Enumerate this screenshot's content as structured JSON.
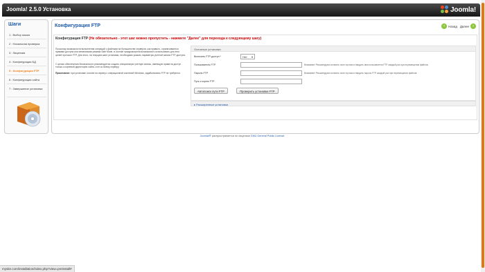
{
  "header": {
    "title": "Joomla! 2.5.0 Установка",
    "logo_text": "Joomla!"
  },
  "sidebar": {
    "title": "Шаги",
    "steps": [
      {
        "label": "1 : Выбор языка"
      },
      {
        "label": "2 : Начальная проверка"
      },
      {
        "label": "3 : Лицензия"
      },
      {
        "label": "4 : Конфигурация БД"
      },
      {
        "label": "5 : Конфигурация FTP"
      },
      {
        "label": "6 : Конфигурация сайта"
      },
      {
        "label": "7 : Завершение установки"
      }
    ],
    "active_step": 4
  },
  "main": {
    "title": "Конфигурация FTP",
    "back_label": "Назад",
    "next_label": "Далее",
    "section_title": "Конфигурация FTP",
    "section_note": "(Не обязательно - этот шаг можно пропустить - нажмите \"Далее\" для перехода к следующему шагу)",
    "intro_1": "Поскольку возможности выполнения операций с файлами на большинстве серверов, как правило, ограничиваются правами доступа или механизмом режима Safe Mode, в Joomla! предусмотрена возможность использовать для этих целей протокол FTP. Для этого, на текущем шаге установки, необходимо указать параметры учетной записи FTP-доступа.",
    "intro_2": "С целью обеспечения безопасности рекомендуется создать специальную учетную запись, имеющую права на доступ только к корневой директории сайта, а не ко всему серверу.",
    "intro_3_bold": "Примечание:",
    "intro_3": "при установке Joomla! на сервер с операционной системой Windows, задействовать FTP не требуется.",
    "settings": {
      "header": "Основные установки",
      "enable_label": "Включить FTP-доступ:*",
      "enable_value": "Нет",
      "user_label": "Пользователь FTP",
      "user_value": "",
      "user_hint": "Внимание! Рекомендуем оставить поле пустым и вводить имя пользователя FTP каждый раз при перемещении файлов.",
      "password_label": "Пароль FTP",
      "password_value": "",
      "password_hint": "Внимание! Рекомендуем оставить поле пустым и вводить пароль FTP каждый раз при перемещении файлов.",
      "path_label": "Путь к корню FTP",
      "path_value": "",
      "autofind_label": "Автопоиск пути FTP",
      "verify_label": "Проверить установки FTP"
    },
    "advanced_label": "Расширенные установки"
  },
  "footer": {
    "joomla": "Joomla!®",
    "text": " распространяется по лицензии ",
    "license": "GNU General Public License."
  },
  "status_url": "mysite.com/installation/index.php?view=preinstall#",
  "colors": {
    "accent_blue": "#1e5aa8",
    "active_orange": "#f17e1a",
    "warning_red": "#cc0000"
  }
}
